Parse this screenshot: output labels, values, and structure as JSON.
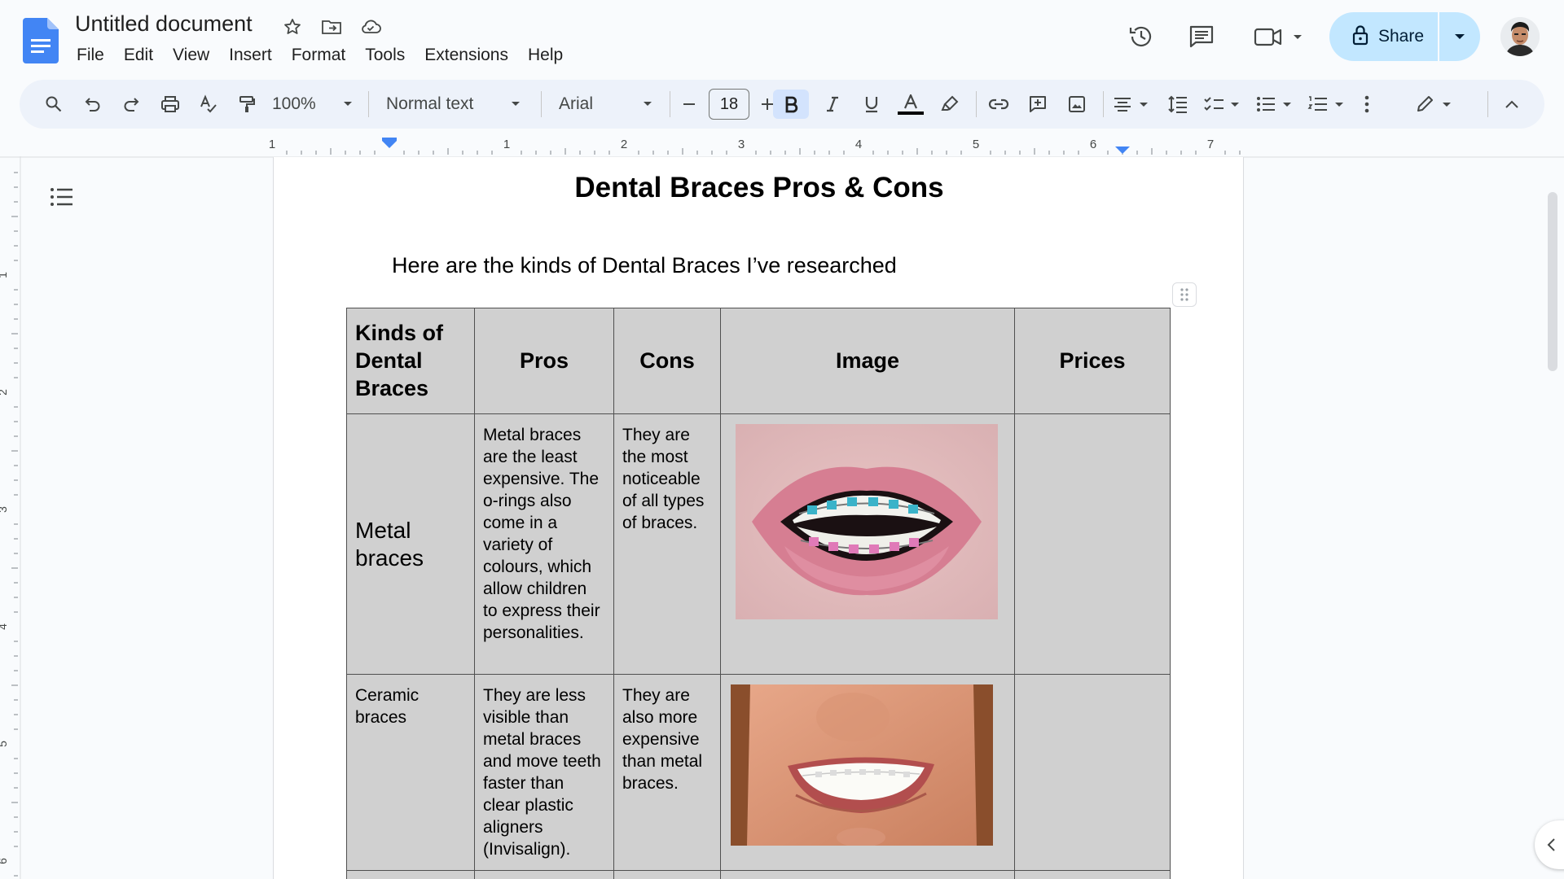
{
  "doc": {
    "title": "Untitled document",
    "menu": [
      "File",
      "Edit",
      "View",
      "Insert",
      "Format",
      "Tools",
      "Extensions",
      "Help"
    ]
  },
  "header": {
    "share_label": "Share"
  },
  "toolbar": {
    "zoom": "100%",
    "style": "Normal text",
    "font": "Arial",
    "font_size": "18"
  },
  "ruler": {
    "h_labels": [
      "1",
      "1",
      "2",
      "3",
      "4",
      "5",
      "6",
      "7"
    ],
    "v_labels": [
      "1",
      "2",
      "3",
      "4",
      "5",
      "6"
    ]
  },
  "content": {
    "heading": "Dental Braces Pros & Cons",
    "intro": "Here are the kinds of Dental Braces I’ve researched",
    "table": {
      "headers": [
        "Kinds of Dental Braces",
        "Pros",
        "Cons",
        "Image",
        "Prices"
      ],
      "rows": [
        {
          "kind": "Metal braces",
          "pros": "Metal braces are the least expensive. The o-rings also come in a variety of colours, which allow children to express their personalities.",
          "cons": "They are the most noticeable of all types of braces.",
          "price": ""
        },
        {
          "kind": "Ceramic braces",
          "pros": "They are less visible than metal braces and move teeth faster than clear plastic aligners (Invisalign).",
          "cons": "They are also more expensive than metal braces.",
          "price": ""
        }
      ]
    }
  },
  "colors": {
    "accent": "#0b57d0",
    "share_bg": "#c2e7ff",
    "toolbar_bg": "#edf2fa",
    "table_bg": "#d0d0d0"
  }
}
